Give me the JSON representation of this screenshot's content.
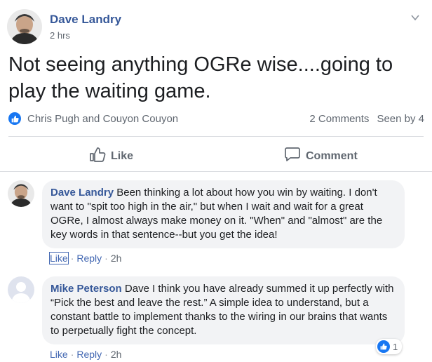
{
  "post": {
    "author": "Dave Landry",
    "time": "2 hrs",
    "text": "Not seeing anything OGRe wise....going to play the waiting game.",
    "reactors": "Chris Pugh and Couyon Couyon",
    "comments_count": "2 Comments",
    "seen_by": "Seen by 4"
  },
  "actions": {
    "like": "Like",
    "comment": "Comment"
  },
  "comments": [
    {
      "author": "Dave Landry",
      "text": "Been thinking a lot about how you win by waiting. I don't want to \"spit too high in the air,\" but when I wait and wait for a great OGRe, I almost always make money on it. \"When\" and \"almost\" are the key words in that sentence--but you get the idea!",
      "like": "Like",
      "reply": "Reply",
      "time": "2h"
    },
    {
      "author": "Mike Peterson",
      "text": "Dave I think you have already summed it up perfectly with “Pick the best and leave the rest.” A simple idea to understand, but a constant battle to implement thanks to the wiring in our brains that wants to perpetually fight the concept.",
      "like": "Like",
      "reply": "Reply",
      "time": "2h",
      "reaction_count": "1"
    }
  ],
  "colors": {
    "link": "#365899",
    "brand": "#1877f2",
    "muted": "#606770",
    "bubble": "#f2f3f5"
  },
  "icons": [
    "like-icon",
    "comment-icon",
    "chevron-down-icon",
    "thumbs-up-icon"
  ]
}
